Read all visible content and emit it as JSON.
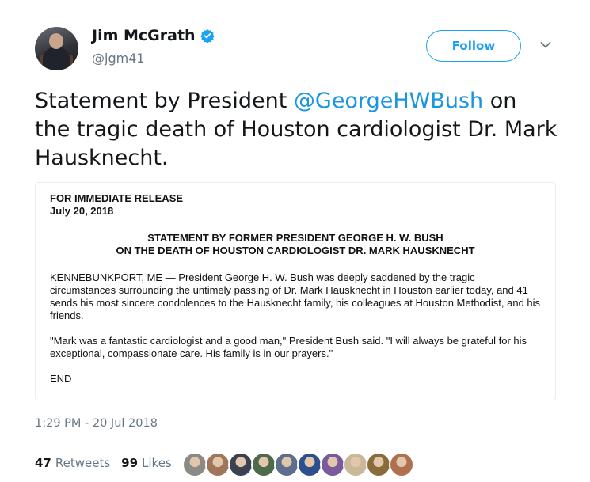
{
  "user": {
    "name": "Jim McGrath",
    "handle": "@jgm41",
    "verified_icon": "verified-badge-icon",
    "follow_label": "Follow"
  },
  "tweet": {
    "text_before": "Statement by President ",
    "mention": "@GeorgeHWBush",
    "text_after": " on the tragic death of Houston cardiologist Dr. Mark Hausknecht."
  },
  "press_release": {
    "line1": "FOR IMMEDIATE RELEASE",
    "line2": "July 20, 2018",
    "heading1": "STATEMENT BY FORMER PRESIDENT GEORGE H. W. BUSH",
    "heading2": "ON THE DEATH OF HOUSTON CARDIOLOGIST DR. MARK HAUSKNECHT",
    "paragraph1": "KENNEBUNKPORT, ME — President George H. W. Bush was deeply saddened by the tragic circumstances surrounding the untimely passing of Dr. Mark Hausknecht in Houston earlier today, and 41 sends his most sincere condolences to the Hausknecht family, his colleagues at Houston Methodist, and his friends.",
    "paragraph2": "\"Mark was a fantastic cardiologist and a good man,\" President Bush said. \"I will always be grateful for his exceptional, compassionate care. His family is in our prayers.\"",
    "end": "END"
  },
  "timestamp": "1:29 PM - 20 Jul 2018",
  "stats": {
    "retweets_count": "47",
    "retweets_label": "Retweets",
    "likes_count": "99",
    "likes_label": "Likes"
  },
  "liker_avatars": [
    "#8c8a86",
    "#a0765a",
    "#3b4150",
    "#4d6a4a",
    "#5e6e8c",
    "#2d4f8e",
    "#7a5a9a",
    "#c9b89a",
    "#8a6b3b",
    "#b07050"
  ],
  "colors": {
    "accent": "#1da1f2",
    "mention": "#1b95e0",
    "secondary_text": "#657786"
  }
}
